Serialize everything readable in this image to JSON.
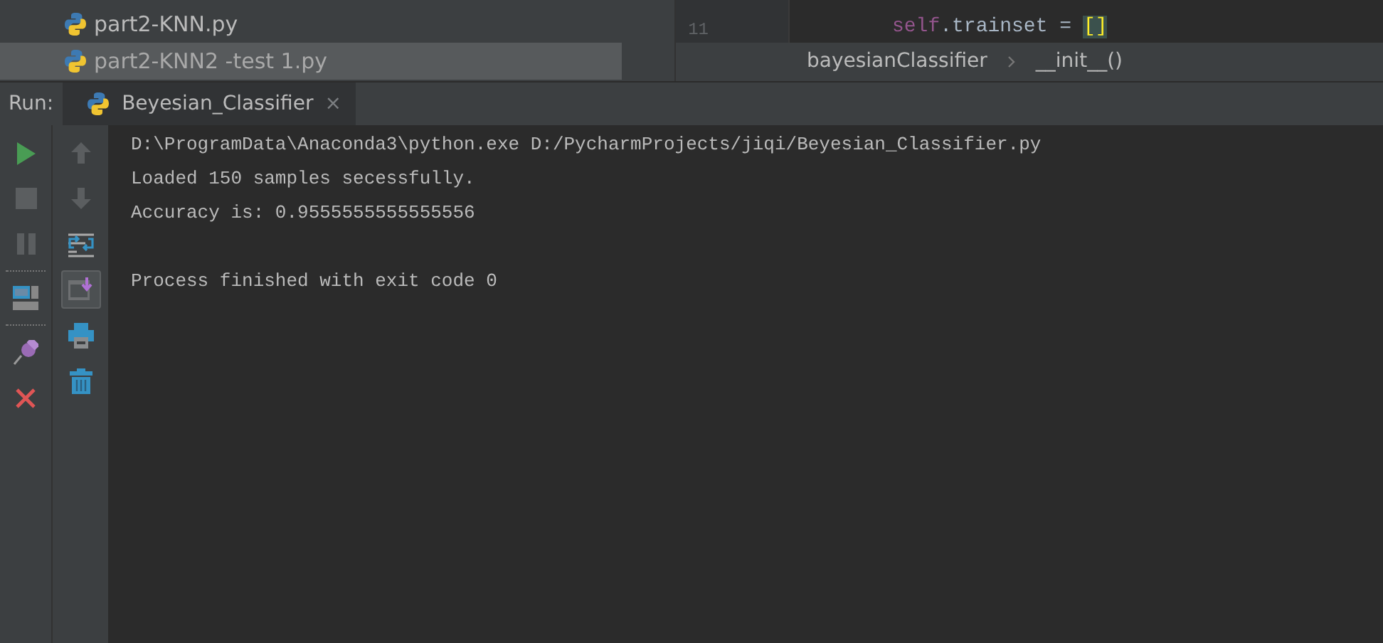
{
  "project_tree": {
    "files": [
      {
        "name": "part2-KNN.py",
        "selected": false
      },
      {
        "name": "part2-KNN2 -test 1.py",
        "selected": true
      }
    ]
  },
  "editor": {
    "line_number": "11",
    "code_tokens": [
      {
        "text": "self",
        "kind": "keyword"
      },
      {
        "text": ".trainset = ",
        "kind": "plain"
      },
      {
        "text": "[]",
        "kind": "bracket"
      }
    ],
    "breadcrumbs": [
      "bayesianClassifier",
      "__init__()"
    ]
  },
  "run_panel": {
    "label": "Run:",
    "tabs": [
      {
        "title": "Beyesian_Classifier",
        "selected": true,
        "close": "×"
      }
    ],
    "left_toolbar": [
      {
        "kind": "run",
        "disabled": false
      },
      {
        "kind": "stop",
        "disabled": true
      },
      {
        "kind": "pause",
        "disabled": true
      },
      {
        "kind": "separator"
      },
      {
        "kind": "layout"
      },
      {
        "kind": "separator"
      },
      {
        "kind": "pin"
      },
      {
        "kind": "close"
      }
    ],
    "right_toolbar": [
      {
        "kind": "up",
        "disabled": true
      },
      {
        "kind": "down",
        "disabled": true
      },
      {
        "kind": "wrap",
        "on": false
      },
      {
        "kind": "scroll-end",
        "on": true
      },
      {
        "kind": "print"
      },
      {
        "kind": "trash"
      }
    ],
    "console_lines": [
      "D:\\ProgramData\\Anaconda3\\python.exe D:/PycharmProjects/jiqi/Beyesian_Classifier.py",
      "Loaded 150 samples secessfully.",
      "Accuracy is: 0.9555555555555556"
    ],
    "exit_message": "Process finished with exit code 0"
  }
}
